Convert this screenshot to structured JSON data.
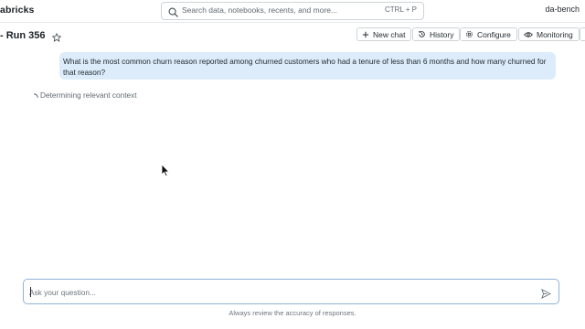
{
  "topbar": {
    "brand": "abricks",
    "search_placeholder": "Search data, notebooks, recents, and more...",
    "search_shortcut": "CTRL + P",
    "user": "da-bench"
  },
  "header": {
    "title": "- Run 356",
    "buttons": {
      "new_chat": "New chat",
      "history": "History",
      "configure": "Configure",
      "monitoring": "Monitoring"
    }
  },
  "conversation": {
    "user_message": "What is the most common churn reason reported among churned customers who had a tenure of less than 6 months and how many churned for that reason?",
    "status_text": "Determining relevant context"
  },
  "composer": {
    "placeholder": "Ask your question...",
    "disclaimer": "Always review the accuracy of responses."
  },
  "icons": {
    "search": "search-icon",
    "star": "star-icon",
    "plus": "plus-icon",
    "history": "history-icon",
    "gear": "gear-icon",
    "eye": "eye-icon",
    "spinner": "spinner-icon",
    "send": "send-icon",
    "cursor": "mouse-pointer-icon"
  },
  "colors": {
    "user_bubble": "#dcecfa",
    "composer_border": "#8fb4d6"
  }
}
